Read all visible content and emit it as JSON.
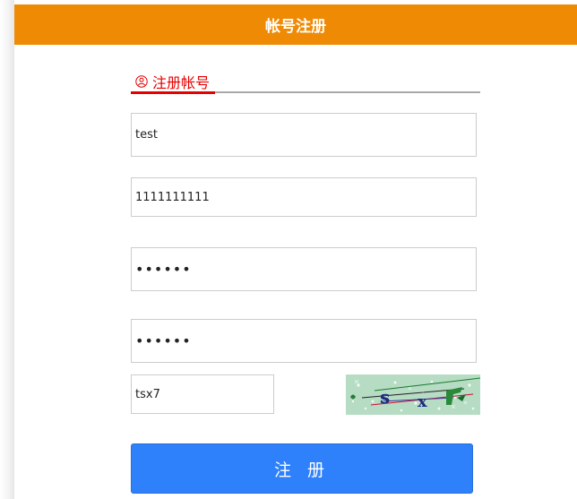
{
  "header": {
    "title": "帐号注册"
  },
  "section": {
    "title": "注册帐号",
    "icon": "user-icon"
  },
  "form": {
    "username_value": "test",
    "phone_value": "1111111111",
    "password_value": "••••••",
    "confirm_password_value": "••••••",
    "captcha_value": "tsx7",
    "captcha_image": "captcha-image"
  },
  "submit": {
    "label": "注 册"
  },
  "colors": {
    "header_bg": "#ef8a05",
    "section_accent": "#e60000",
    "button_bg": "#2f81fb"
  }
}
